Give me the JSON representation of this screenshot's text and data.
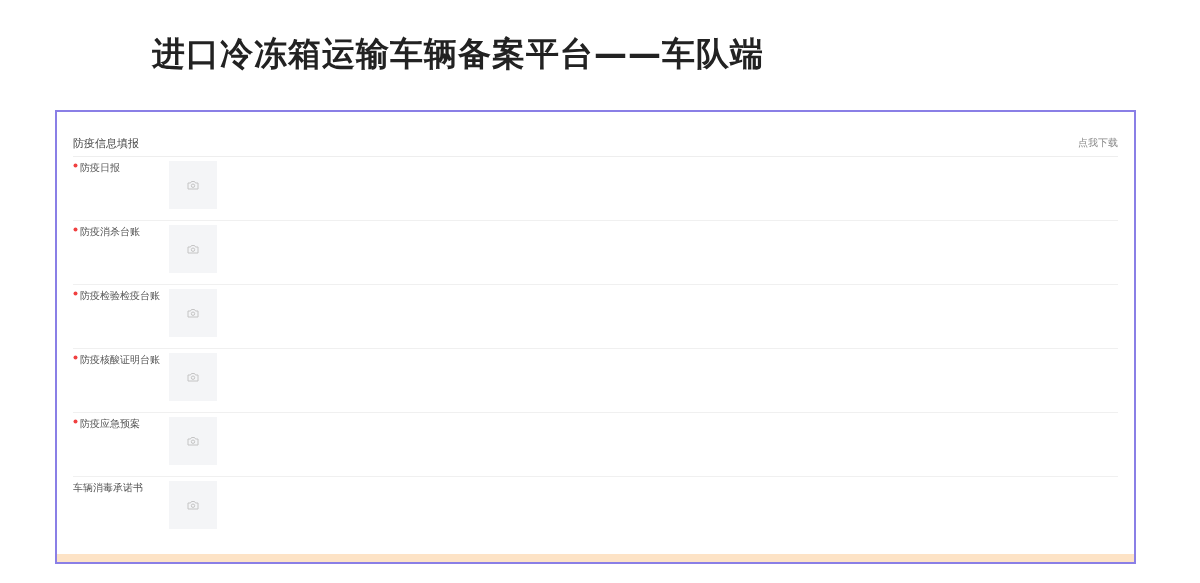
{
  "page_title": "进口冷冻箱运输车辆备案平台——车队端",
  "form": {
    "title": "防疫信息填报",
    "download_link": "点我下载",
    "fields": [
      {
        "label": "防疫日报",
        "required": true
      },
      {
        "label": "防疫消杀台账",
        "required": true
      },
      {
        "label": "防疫检验检疫台账",
        "required": true
      },
      {
        "label": "防疫核酸证明台账",
        "required": true
      },
      {
        "label": "防疫应急预案",
        "required": true
      },
      {
        "label": "车辆消毒承诺书",
        "required": false
      }
    ]
  }
}
